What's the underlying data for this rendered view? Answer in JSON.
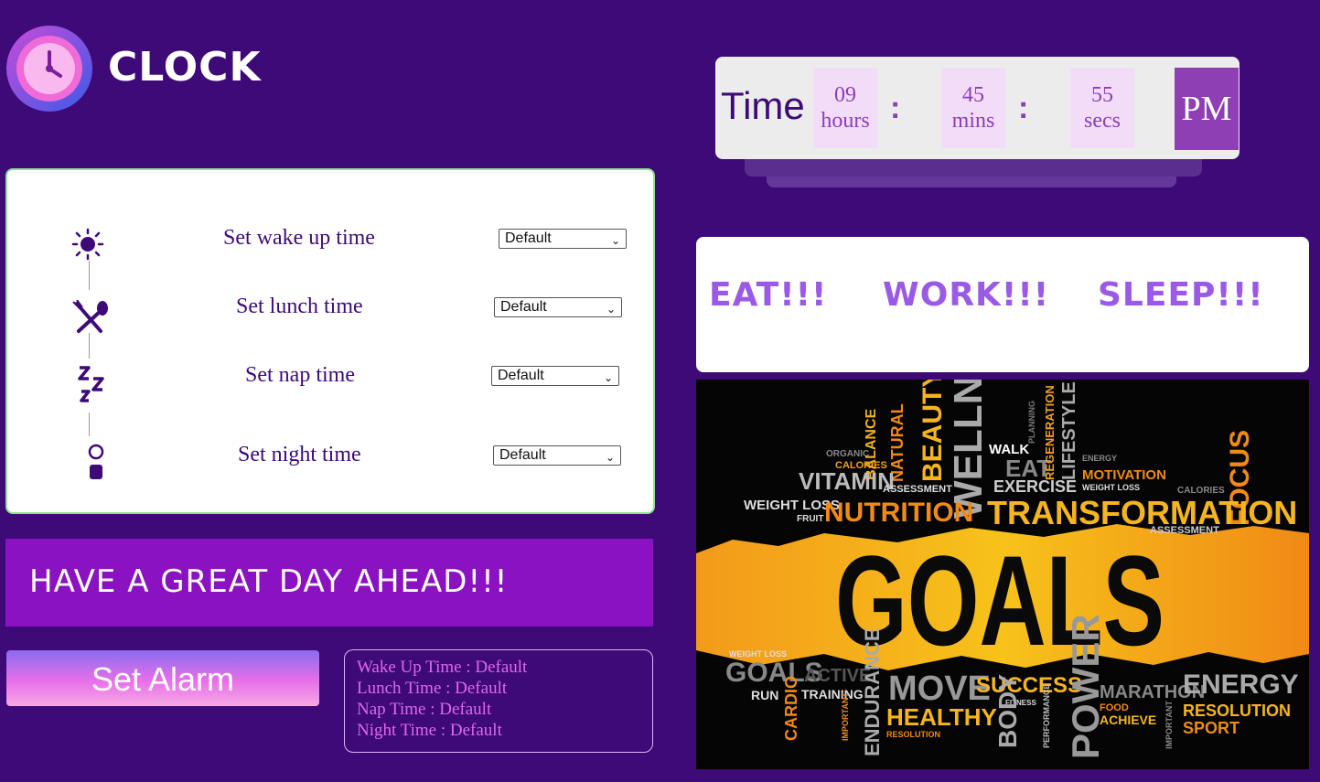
{
  "app": {
    "logo_text": "CLOCK"
  },
  "clock": {
    "label": "Time",
    "hours_value": "09",
    "hours_unit": "hours",
    "mins_value": "45",
    "mins_unit": "mins",
    "secs_value": "55",
    "secs_unit": "secs",
    "separator": ":",
    "ampm": "PM"
  },
  "alarms": {
    "items": [
      {
        "label": "Set wake up time",
        "selected": "Default",
        "icon": "sun-icon"
      },
      {
        "label": "Set lunch time",
        "selected": "Default",
        "icon": "fork-spoon-icon"
      },
      {
        "label": "Set nap time",
        "selected": "Default",
        "icon": "zzz-icon"
      },
      {
        "label": "Set night time",
        "selected": "Default",
        "icon": "moon-night-icon"
      }
    ]
  },
  "banner": {
    "text": "HAVE A GREAT DAY AHEAD!!!"
  },
  "button": {
    "set_alarm": "Set Alarm"
  },
  "summary": {
    "wake": "Wake Up Time : Default",
    "lunch": "Lunch Time : Default",
    "nap": "Nap Time : Default",
    "night": "Night Time : Default"
  },
  "motto": {
    "eat": "EAT!!!",
    "work": "WORK!!!",
    "sleep": "SLEEP!!!"
  },
  "goals_image": {
    "main": "GOALS",
    "words": [
      "ORGANIC",
      "BALANCE",
      "CALORIES",
      "NATURAL",
      "BEAUTY",
      "WELLNESS",
      "WALK",
      "EAT",
      "PLANNING",
      "REGENERATION",
      "LIFESTYLE",
      "ENERGY",
      "MOTIVATION",
      "WEIGHT LOSS",
      "VITAMIN",
      "ASSESSMENT",
      "EXERCISE",
      "CALORIES",
      "FOCUS",
      "WEIGHT LOSS",
      "FRUIT",
      "NUTRITION",
      "TRANSFORMATION",
      "ASSESSMENT",
      "WEIGHT LOSS",
      "GOALS",
      "ACTIVE",
      "RUN",
      "TRAINING",
      "CARDIO",
      "IMPORTANT",
      "ENDURANCE",
      "MOVE",
      "HEALTHY",
      "RESOLUTION",
      "SUCCESS",
      "FITNESS",
      "BODY",
      "PERFORMANCE",
      "POWER",
      "MARATHON",
      "FOOD",
      "ACHIEVE",
      "ENERGY",
      "IMPORTANT",
      "RESOLUTION",
      "SPORT"
    ]
  },
  "colors": {
    "background": "#3d0a78",
    "accent": "#8a12c0",
    "ampm_bg": "#8e3fb3",
    "motto": "#9a5ae6"
  }
}
